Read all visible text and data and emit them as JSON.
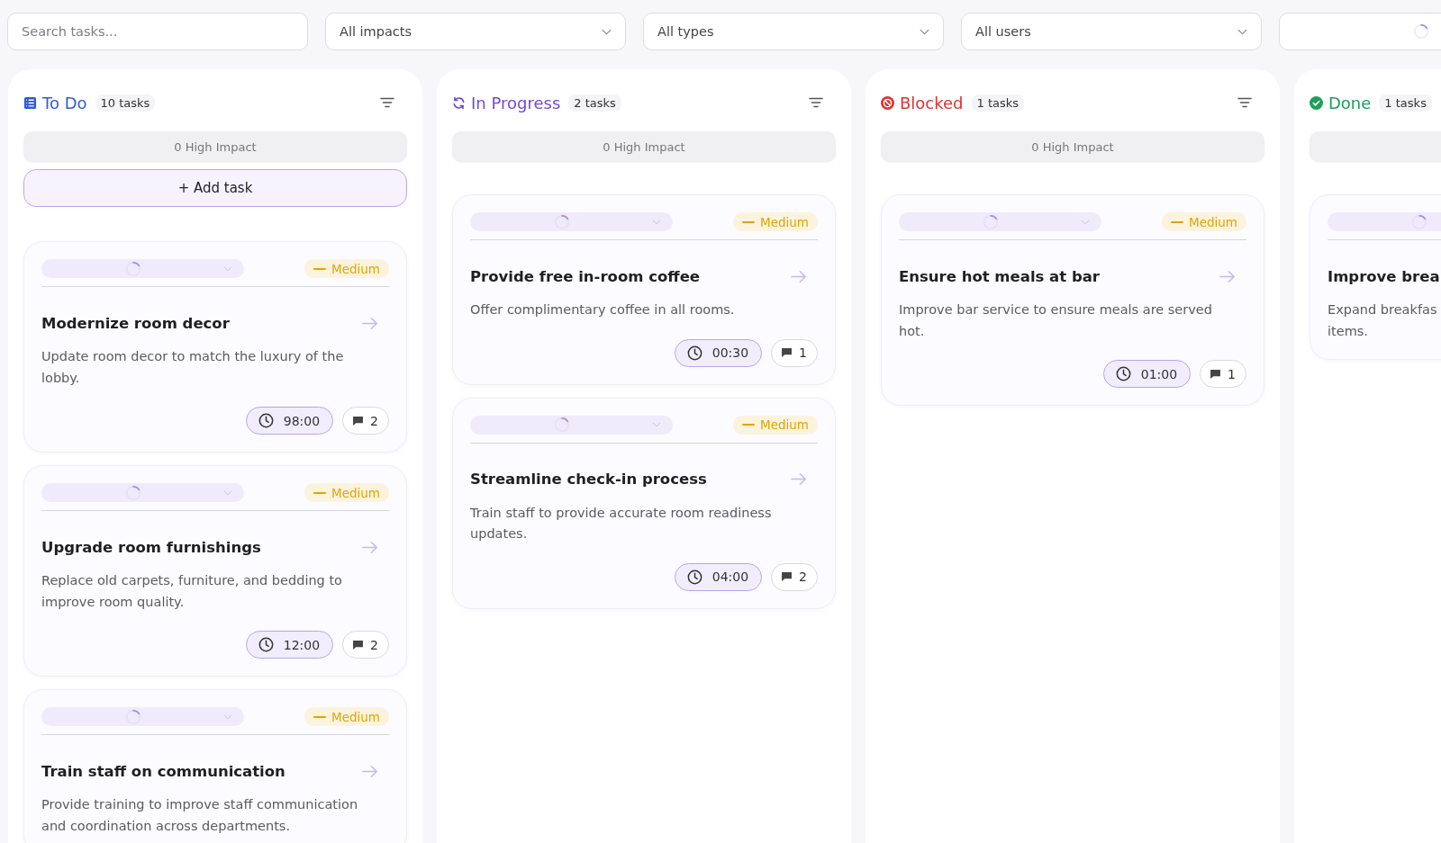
{
  "filters": {
    "search": {
      "placeholder": "Search tasks..."
    },
    "selects": [
      {
        "value": "All impacts",
        "loading": false
      },
      {
        "value": "All types",
        "loading": false
      },
      {
        "value": "All users",
        "loading": false
      },
      {
        "loading": true
      }
    ]
  },
  "columns": [
    {
      "kind": "todo",
      "title": "To Do",
      "color": "#2f5bd8",
      "count": "10 tasks",
      "filter_button": true,
      "high_impact": "0 High Impact",
      "add_task": "+ Add task",
      "cards": [
        {
          "loading": true,
          "priority": {
            "label": "Medium",
            "color": "#e0a500"
          },
          "title": "Modernize room decor",
          "open_button": true,
          "description": "Update room decor to match the luxury of the lobby.",
          "time": "98:00",
          "comments": "2"
        },
        {
          "loading": true,
          "priority": {
            "label": "Medium",
            "color": "#e0a500"
          },
          "title": "Upgrade room furnishings",
          "open_button": true,
          "description": "Replace old carpets, furniture, and bedding to improve room quality.",
          "time": "12:00",
          "comments": "2"
        },
        {
          "loading": true,
          "priority": {
            "label": "Medium",
            "color": "#e0a500"
          },
          "title": "Train staff on communication",
          "open_button": true,
          "description": "Provide training to improve staff communication and coordination across departments."
        }
      ]
    },
    {
      "kind": "in_progress",
      "title": "In Progress",
      "color": "#7048e0",
      "count": "2 tasks",
      "filter_button": true,
      "high_impact": "0 High Impact",
      "cards": [
        {
          "loading": true,
          "priority": {
            "label": "Medium",
            "color": "#e0a500"
          },
          "title": "Provide free in-room coffee",
          "open_button": true,
          "description": "Offer complimentary coffee in all rooms.",
          "time": "00:30",
          "comments": "1"
        },
        {
          "loading": true,
          "priority": {
            "label": "Medium",
            "color": "#e0a500"
          },
          "title": "Streamline check-in process",
          "open_button": true,
          "description": "Train staff to provide accurate room readiness updates.",
          "time": "04:00",
          "comments": "2"
        }
      ]
    },
    {
      "kind": "blocked",
      "title": "Blocked",
      "color": "#e03131",
      "count": "1 tasks",
      "filter_button": true,
      "high_impact": "0 High Impact",
      "cards": [
        {
          "loading": true,
          "priority": {
            "label": "Medium",
            "color": "#e0a500"
          },
          "title": "Ensure hot meals at bar",
          "open_button": true,
          "description": "Improve bar service to ensure meals are served hot.",
          "time": "01:00",
          "comments": "1"
        }
      ]
    },
    {
      "kind": "done",
      "title": "Done",
      "color": "#1e9e5a",
      "count": "1 tasks",
      "cards": [
        {
          "loading": true,
          "title": "Improve brea",
          "description": "Expand breakfas\nitems."
        }
      ]
    }
  ]
}
